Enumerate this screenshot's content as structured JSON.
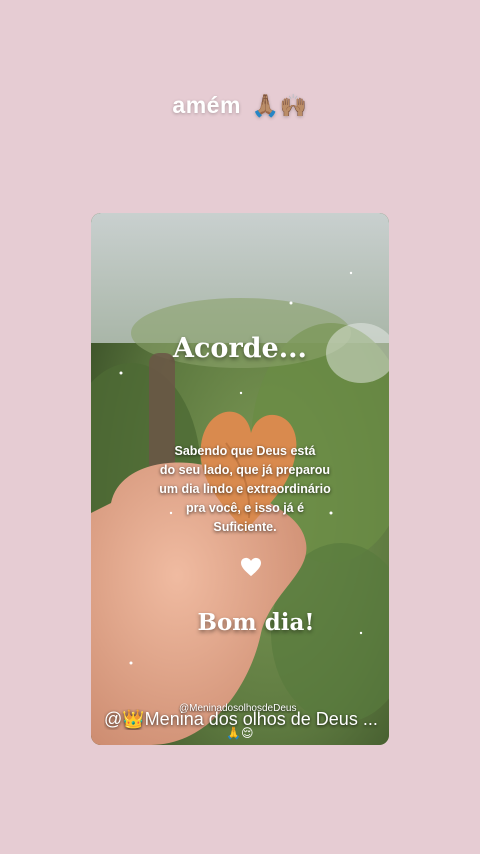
{
  "caption": {
    "text": "amém",
    "emojis": "🙏🏽🙌🏽"
  },
  "card": {
    "title": "Acorde...",
    "message": "Sabendo que Deus está\ndo  seu lado, que já preparou\num dia lindo e extraordinário\npra você, e isso já é\nSuficiente.",
    "heart_icon": "white-heart-icon",
    "greeting": "Bom dia!",
    "watermark": "@MeninadosolhosdeDeus",
    "handle": "@👑Menina dos olhos de Deus ...",
    "handle_emojis": "🙏😌"
  },
  "colors": {
    "page_background": "#e6ccd3",
    "text": "#ffffff",
    "leaf": "#d98a4e"
  }
}
